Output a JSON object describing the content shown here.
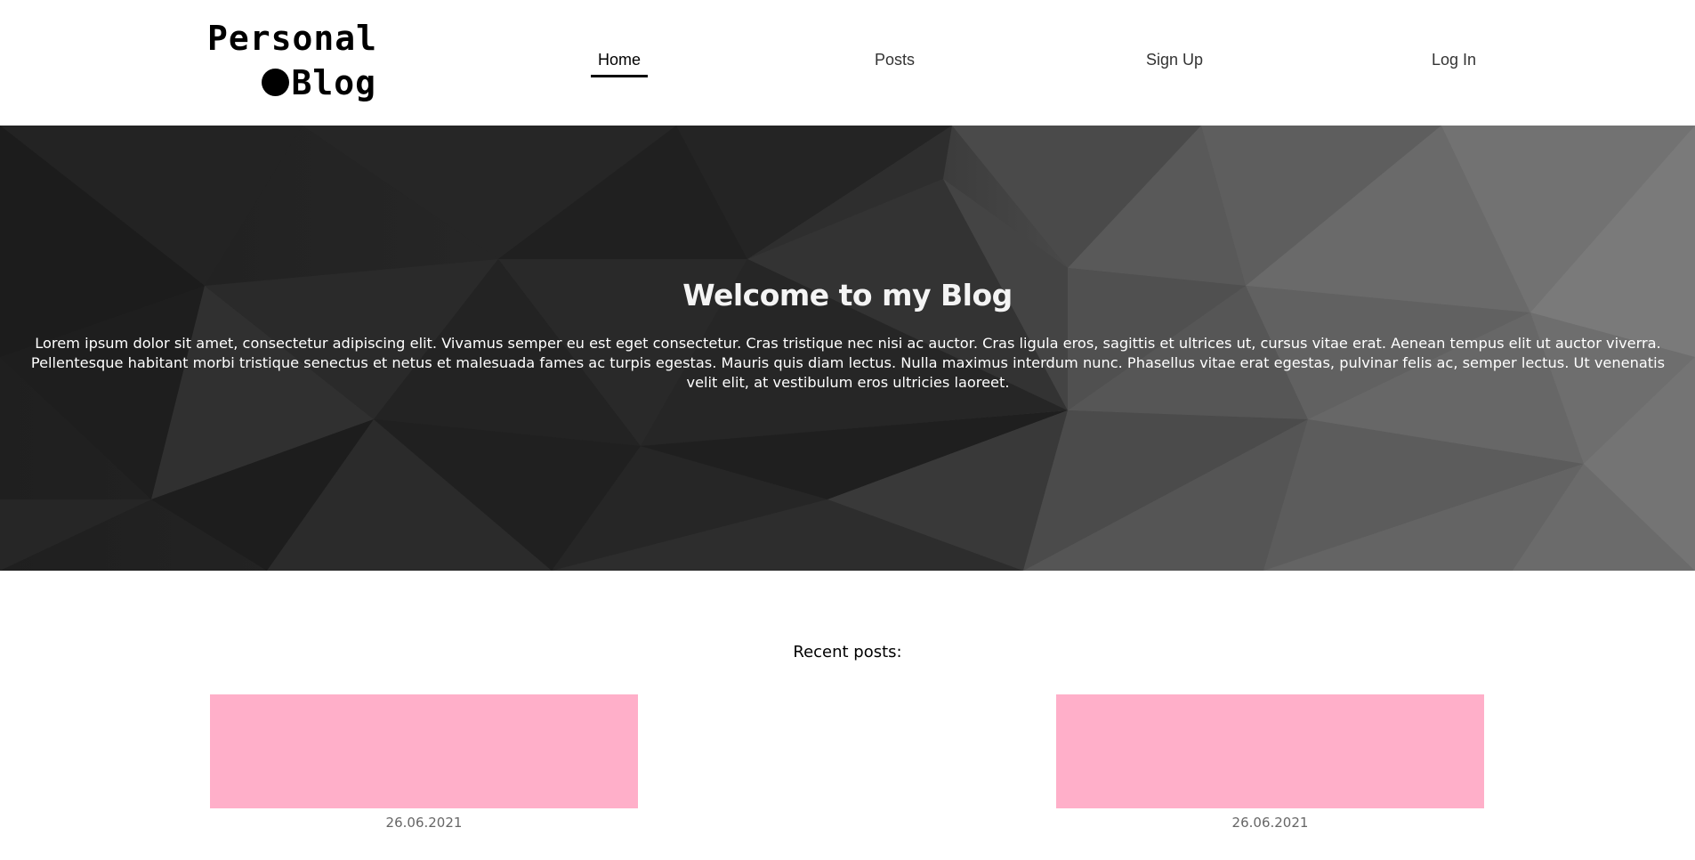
{
  "logo": {
    "line1": "Personal",
    "line2": "Blog"
  },
  "nav": {
    "home": "Home",
    "posts": "Posts",
    "signup": "Sign Up",
    "login": "Log In"
  },
  "hero": {
    "title": "Welcome to my Blog",
    "text": "Lorem ipsum dolor sit amet, consectetur adipiscing elit. Vivamus semper eu est eget consectetur. Cras tristique nec nisi ac auctor. Cras ligula eros, sagittis et ultrices ut, cursus vitae erat. Aenean tempus elit ut auctor viverra. Pellentesque habitant morbi tristique senectus et netus et malesuada fames ac turpis egestas. Mauris quis diam lectus. Nulla maximus interdum nunc. Phasellus vitae erat egestas, pulvinar felis ac, semper lectus. Ut venenatis velit elit, at vestibulum eros ultricies laoreet."
  },
  "recent": {
    "title": "Recent posts:",
    "posts": [
      {
        "date": "26.06.2021",
        "image_color": "#ffafc9"
      },
      {
        "date": "26.06.2021",
        "image_color": "#ffafc9"
      }
    ]
  },
  "colors": {
    "accent": "#000000",
    "post_image": "#ffafc9"
  }
}
